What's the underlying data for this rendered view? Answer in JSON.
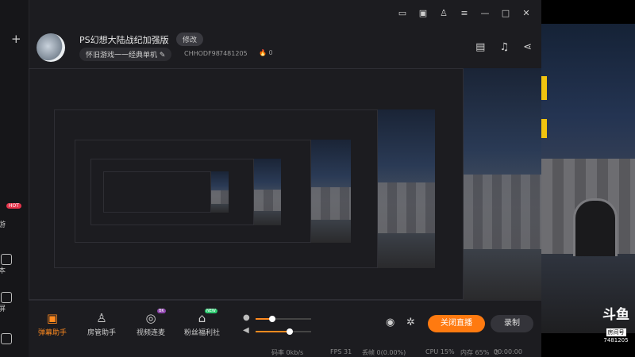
{
  "titlebar": {
    "icons": [
      "monitor-icon",
      "screenshot-icon",
      "shirt-icon",
      "menu-icon",
      "minimize-icon",
      "maximize-icon",
      "close-icon"
    ]
  },
  "sidebar": {
    "add_label": "+",
    "items": [
      {
        "label": "游",
        "badge": "HOT"
      },
      {
        "label": "本"
      },
      {
        "label": "屏"
      },
      {
        "label": ""
      }
    ]
  },
  "header": {
    "room_title": "PS幻想大陆战纪加强版",
    "edit_label": "修改",
    "category": "怀旧游戏一一经典单机",
    "room_code": "CHHODF98",
    "room_id": "7481205",
    "fire_count": "0"
  },
  "bottom": {
    "tools": [
      {
        "label": "弹幕助手",
        "icon": "danmaku-icon",
        "active": true
      },
      {
        "label": "房管助手",
        "icon": "admin-icon",
        "active": false
      },
      {
        "label": "视频连麦",
        "icon": "video-call-icon",
        "active": false,
        "tag": "BK"
      },
      {
        "label": "粉丝福利社",
        "icon": "gift-icon",
        "active": false,
        "tag": "NEW"
      }
    ],
    "mic_level": 0.3,
    "speaker_level": 0.62,
    "close_live_label": "关闭直播",
    "record_label": "录制"
  },
  "status": {
    "bitrate": "码率 0kb/s",
    "fps": "FPS 31",
    "dropped": "丢帧 0(0.00%)",
    "cpu": "CPU 15%",
    "memory": "内存 65%",
    "timer": "00:00:00"
  },
  "stream": {
    "logo_mark": "斗鱼",
    "logo_room": "房间号",
    "logo_number": "7481205"
  },
  "colors": {
    "accent": "#ff7a10",
    "background": "#1c1c20"
  }
}
